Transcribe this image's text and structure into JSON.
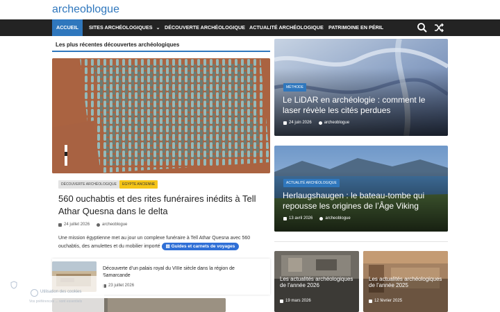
{
  "site": {
    "title": "archeoblogue"
  },
  "nav": {
    "items": [
      {
        "label": "ACCUEIL"
      },
      {
        "label": "SITES ARCHÉOLOGIQUES"
      },
      {
        "label": "DÉCOUVERTE ARCHÉOLOGIQUE"
      },
      {
        "label": "ACTUALITÉ ARCHÉOLOGIQUE"
      },
      {
        "label": "PATRIMOINE EN PÉRIL"
      }
    ],
    "search_icon": "search-icon",
    "shuffle_icon": "shuffle-icon"
  },
  "section": {
    "title": "Les plus récentes découvertes archéologiques"
  },
  "featured": {
    "categories": [
      "DÉCOUVERTE ARCHÉOLOGIQUE",
      "EGYPTE ANCIENNE"
    ],
    "title": "560 ouchabtis et des rites funéraires inédits à Tell Athar Quesna dans le delta",
    "date": "24 juillet 2026",
    "author": "archeoblogue",
    "excerpt": "Une mission égyptienne met au jour un complexe funéraire à Tell Athar Quesna avec 560 ouchabtis, des amulettes et du mobilier importé",
    "guide_label": "Guides et carnets de voyages"
  },
  "list": [
    {
      "title": "Découverte d’un palais royal du VIIIe siècle dans la région de Samarcande",
      "date": "23 juillet 2026"
    }
  ],
  "cards": [
    {
      "category": "MÉTHODE",
      "title": "Le LiDAR en archéologie : comment le laser révèle les cités perdues",
      "date": "24 juin 2026",
      "author": "archeoblogue"
    },
    {
      "category": "ACTUALITÉ ARCHÉOLOGIQUE",
      "title": "Herlaugshaugen : le bateau-tombe qui repousse les origines de l’Âge Viking",
      "date": "13 avril 2026",
      "author": "archeoblogue"
    }
  ],
  "small_cards": [
    {
      "title": "Les actualités archéologiques de l’année 2026",
      "date": "19 mars 2026"
    },
    {
      "title": "Les actualités archéologiques de l’année 2025",
      "date": "12 février 2025"
    }
  ],
  "cookie": {
    "text": "Utilisation des cookies",
    "sub": "Vos préférences ... sont essentiels"
  },
  "colors": {
    "accent": "#2f77bd",
    "nav_bg": "#232323",
    "badge_yellow": "#f5c518"
  }
}
